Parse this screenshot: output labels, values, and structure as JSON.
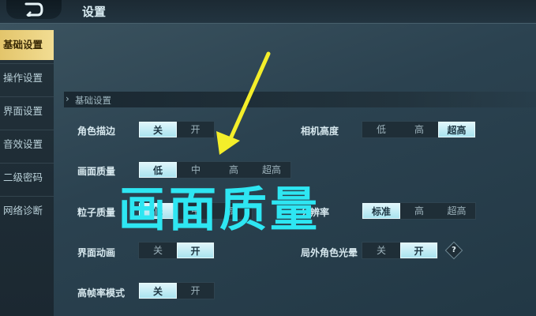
{
  "header": {
    "title": "设置",
    "back_icon": "back-arrow-icon"
  },
  "sidebar": {
    "items": [
      {
        "label": "基础设置",
        "active": true
      },
      {
        "label": "操作设置",
        "active": false
      },
      {
        "label": "界面设置",
        "active": false
      },
      {
        "label": "音效设置",
        "active": false
      },
      {
        "label": "二级密码",
        "active": false
      },
      {
        "label": "网络诊断",
        "active": false
      }
    ]
  },
  "section": {
    "title": "基础设置"
  },
  "settings": {
    "outline": {
      "label": "角色描边",
      "options": [
        "关",
        "开"
      ],
      "selected": "关"
    },
    "camera_height": {
      "label": "相机高度",
      "options": [
        "低",
        "高",
        "超高"
      ],
      "selected": "超高"
    },
    "quality": {
      "label": "画面质量",
      "options": [
        "低",
        "中",
        "高",
        "超高"
      ],
      "selected": "低"
    },
    "particle": {
      "label": "粒子质量",
      "options": [
        "低",
        "中",
        "高"
      ],
      "selected": "低"
    },
    "resolution": {
      "label": "分辨率",
      "options": [
        "标准",
        "高",
        "超高"
      ],
      "selected": "标准"
    },
    "ui_anim": {
      "label": "界面动画",
      "options": [
        "关",
        "开"
      ],
      "selected": "开"
    },
    "outer_glow": {
      "label": "局外角色光晕",
      "options": [
        "关",
        "开"
      ],
      "selected": "开",
      "help": "?"
    },
    "high_fps": {
      "label": "高帧率模式",
      "options": [
        "关",
        "开"
      ],
      "selected": "关"
    }
  },
  "annotation": {
    "text": "画面质量",
    "color": "#2ee6f2",
    "arrow_color": "#f4ee2a"
  },
  "colors": {
    "accent_gold": "#e3c56b",
    "selected_option": "#a9e3ef"
  }
}
